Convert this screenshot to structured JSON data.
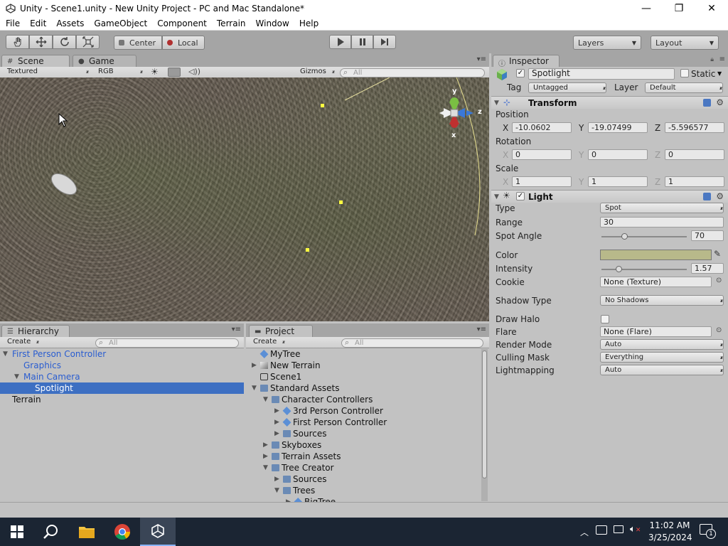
{
  "window": {
    "title": "Unity - Scene1.unity - New Unity Project - PC and Mac Standalone*",
    "minimize": "—",
    "maximize": "❐",
    "close": "✕"
  },
  "menu": [
    "File",
    "Edit",
    "Assets",
    "GameObject",
    "Component",
    "Terrain",
    "Window",
    "Help"
  ],
  "toolbar": {
    "tools": [
      "hand-icon",
      "move-icon",
      "rotate-icon",
      "scale-icon"
    ],
    "pivot": "Center",
    "space": "Local",
    "layers": "Layers",
    "layout": "Layout"
  },
  "scene": {
    "tab_scene": "Scene",
    "tab_game": "Game",
    "render_mode": "Textured",
    "color_mode": "RGB",
    "gizmos": "Gizmos",
    "search_placeholder": "All",
    "axis_y": "y",
    "axis_z": "z",
    "axis_x": "x"
  },
  "hierarchy": {
    "tab": "Hierarchy",
    "create": "Create",
    "search_placeholder": "All",
    "items": [
      {
        "label": "First Person Controller",
        "indent": 0,
        "expanded": true,
        "prefab": true
      },
      {
        "label": "Graphics",
        "indent": 1,
        "expanded": null,
        "prefab": true
      },
      {
        "label": "Main Camera",
        "indent": 1,
        "expanded": true,
        "prefab": true
      },
      {
        "label": "Spotlight",
        "indent": 2,
        "expanded": null,
        "selected": true
      },
      {
        "label": "Terrain",
        "indent": 0,
        "expanded": null
      }
    ]
  },
  "project": {
    "tab": "Project",
    "create": "Create",
    "search_placeholder": "All",
    "items": [
      {
        "label": "MyTree",
        "indent": 0,
        "expanded": null,
        "icon": "prefab"
      },
      {
        "label": "New Terrain",
        "indent": 0,
        "expanded": false,
        "icon": "terrain"
      },
      {
        "label": "Scene1",
        "indent": 0,
        "expanded": null,
        "icon": "unity"
      },
      {
        "label": "Standard Assets",
        "indent": 0,
        "expanded": true,
        "icon": "folder"
      },
      {
        "label": "Character Controllers",
        "indent": 1,
        "expanded": true,
        "icon": "folder"
      },
      {
        "label": "3rd Person Controller",
        "indent": 2,
        "expanded": false,
        "icon": "prefab"
      },
      {
        "label": "First Person Controller",
        "indent": 2,
        "expanded": false,
        "icon": "prefab"
      },
      {
        "label": "Sources",
        "indent": 2,
        "expanded": false,
        "icon": "folder"
      },
      {
        "label": "Skyboxes",
        "indent": 1,
        "expanded": false,
        "icon": "folder"
      },
      {
        "label": "Terrain Assets",
        "indent": 1,
        "expanded": false,
        "icon": "folder"
      },
      {
        "label": "Tree Creator",
        "indent": 1,
        "expanded": true,
        "icon": "folder"
      },
      {
        "label": "Sources",
        "indent": 2,
        "expanded": false,
        "icon": "folder"
      },
      {
        "label": "Trees",
        "indent": 2,
        "expanded": true,
        "icon": "folder"
      },
      {
        "label": "BigTree",
        "indent": 3,
        "expanded": false,
        "icon": "prefab"
      }
    ]
  },
  "inspector": {
    "tab": "Inspector",
    "object_name": "Spotlight",
    "static_label": "Static",
    "tag_label": "Tag",
    "tag_value": "Untagged",
    "layer_label": "Layer",
    "layer_value": "Default",
    "transform": {
      "title": "Transform",
      "position_label": "Position",
      "rotation_label": "Rotation",
      "scale_label": "Scale",
      "x": "X",
      "y": "Y",
      "z": "Z",
      "position": [
        "-10.0602",
        "-19.07499",
        "-5.596577"
      ],
      "rotation": [
        "0",
        "0",
        "0"
      ],
      "scale": [
        "1",
        "1",
        "1"
      ]
    },
    "light": {
      "title": "Light",
      "type_label": "Type",
      "type_value": "Spot",
      "range_label": "Range",
      "range_value": "30",
      "spot_angle_label": "Spot Angle",
      "spot_angle_value": "70",
      "spot_angle_fraction": 0.27,
      "color_label": "Color",
      "color_hex": "#b8b98a",
      "intensity_label": "Intensity",
      "intensity_value": "1.57",
      "intensity_fraction": 0.2,
      "cookie_label": "Cookie",
      "cookie_value": "None (Texture)",
      "shadow_label": "Shadow Type",
      "shadow_value": "No Shadows",
      "halo_label": "Draw Halo",
      "flare_label": "Flare",
      "flare_value": "None (Flare)",
      "render_label": "Render Mode",
      "render_value": "Auto",
      "culling_label": "Culling Mask",
      "culling_value": "Everything",
      "lightmap_label": "Lightmapping",
      "lightmap_value": "Auto"
    }
  },
  "taskbar": {
    "time": "11:02 AM",
    "date": "3/25/2024",
    "notif_count": "1"
  },
  "colors": {
    "selection": "#3d6fc2",
    "prefab_blue": "#2a5dd0",
    "taskbar": "#1b2533"
  }
}
